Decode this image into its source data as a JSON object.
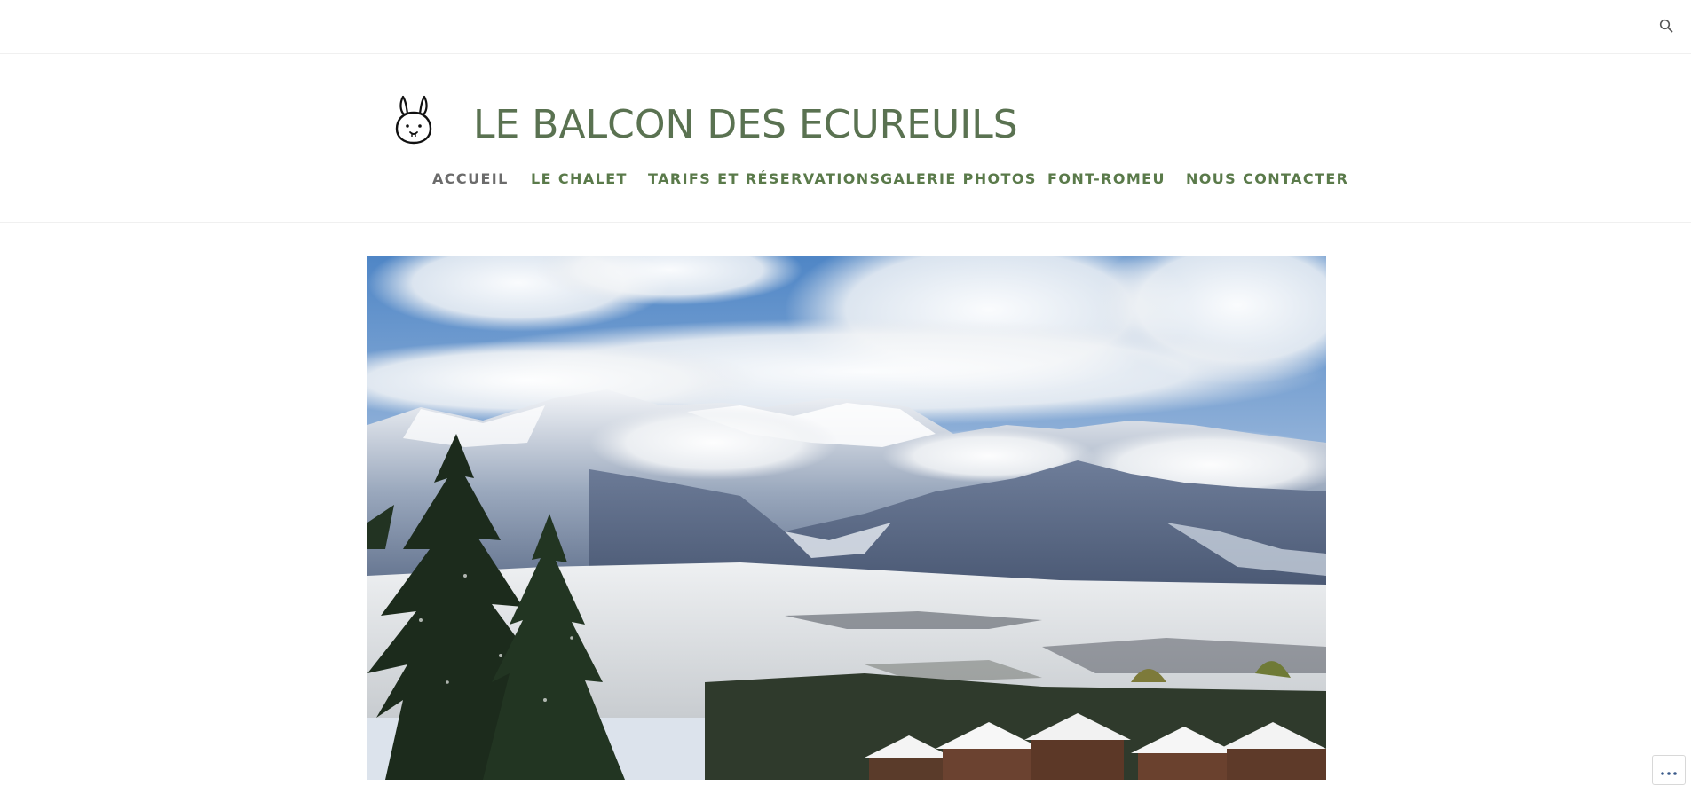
{
  "site": {
    "title": "LE BALCON DES ECUREUILS",
    "logo_icon": "rabbit-logo-icon"
  },
  "topbar": {
    "search_icon": "search-icon"
  },
  "nav": {
    "items": [
      {
        "label": "ACCUEIL",
        "current": true
      },
      {
        "label": "LE CHALET"
      },
      {
        "label": "TARIFS ET RÉSERVATIONS"
      },
      {
        "label": "GALERIE PHOTOS"
      },
      {
        "label": "FONT-ROMEU"
      },
      {
        "label": "NOUS CONTACTER"
      }
    ]
  },
  "hero": {
    "image": "snowy-mountains-pine-tree-photo"
  },
  "actions": {
    "icon": "ellipsis-icon"
  },
  "colors": {
    "title": "#5a7251",
    "nav_link": "#5a7a4a",
    "nav_current": "#6b6b6b",
    "border": "#f0f0f0"
  }
}
